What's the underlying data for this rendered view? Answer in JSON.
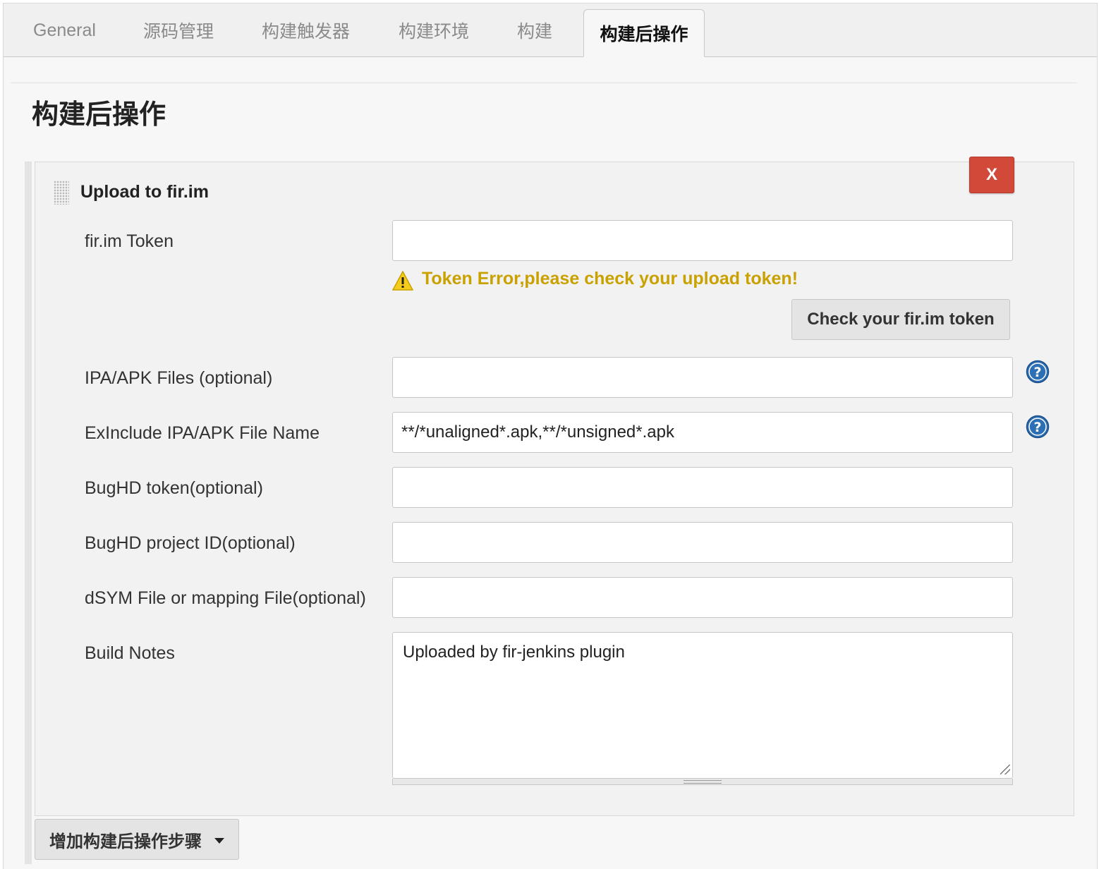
{
  "tabs": [
    {
      "label": "General"
    },
    {
      "label": "源码管理"
    },
    {
      "label": "构建触发器"
    },
    {
      "label": "构建环境"
    },
    {
      "label": "构建"
    },
    {
      "label": "构建后操作"
    }
  ],
  "section_title": "构建后操作",
  "panel": {
    "title": "Upload to fir.im",
    "delete_label": "X",
    "warning_text": "Token Error,please check your upload token!",
    "check_button_label": "Check your fir.im token",
    "fields": {
      "token": {
        "label": "fir.im Token",
        "value": ""
      },
      "files": {
        "label": "IPA/APK Files (optional)",
        "value": ""
      },
      "exclude": {
        "label": "ExInclude IPA/APK File Name",
        "value": "**/*unaligned*.apk,**/*unsigned*.apk"
      },
      "bughd_token": {
        "label": "BugHD token(optional)",
        "value": ""
      },
      "bughd_project": {
        "label": "BugHD project ID(optional)",
        "value": ""
      },
      "dsym": {
        "label": "dSYM File or mapping File(optional)",
        "value": ""
      },
      "notes": {
        "label": "Build Notes",
        "value": "Uploaded by fir-jenkins plugin"
      }
    }
  },
  "add_step_label": "增加构建后操作步骤",
  "colors": {
    "delete_red": "#d24939",
    "warning_yellow": "#c9a100",
    "help_blue": "#2c6fb5"
  },
  "icons": {
    "warning": "warning-triangle-icon",
    "help": "question-mark-icon",
    "dropdown": "caret-down-icon",
    "drag": "drag-handle-icon"
  }
}
